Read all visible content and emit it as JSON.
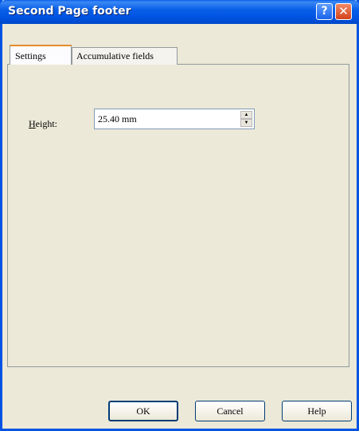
{
  "dialog": {
    "title": "Second Page footer",
    "help_glyph": "?",
    "close_glyph": "✕"
  },
  "tabs": [
    {
      "label": "Settings",
      "selected": true
    },
    {
      "label": "Accumulative fields",
      "selected": false
    }
  ],
  "settings": {
    "height_label_prefix": "H",
    "height_label_rest": "eight:",
    "height_value": "25.40 mm",
    "spin_up_glyph": "▲",
    "spin_down_glyph": "▼"
  },
  "buttons": {
    "ok": "OK",
    "cancel": "Cancel",
    "help": "Help"
  },
  "colors": {
    "titlebar": "#0054e3",
    "dialog_bg": "#ece9d8",
    "tab_accent": "#e68b2c"
  }
}
